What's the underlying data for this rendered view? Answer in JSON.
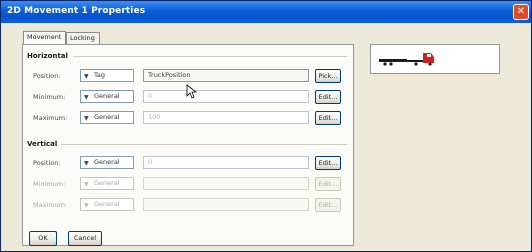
{
  "window": {
    "title": "2D Movement 1 Properties"
  },
  "tabs": [
    {
      "label": "Movement"
    },
    {
      "label": "Locking"
    }
  ],
  "horizontal": {
    "heading": "Horizontal",
    "position": {
      "label": "Position:",
      "type": "Tag",
      "value": "TruckPosition",
      "button": "Pick..."
    },
    "minimum": {
      "label": "Minimum:",
      "type": "General",
      "value": "0",
      "button": "Edit..."
    },
    "maximum": {
      "label": "Maximum:",
      "type": "General",
      "value": "100",
      "button": "Edit..."
    }
  },
  "vertical": {
    "heading": "Vertical",
    "position": {
      "label": "Position:",
      "type": "General",
      "value": "0",
      "button": "Edit..."
    },
    "minimum": {
      "label": "Minimum:",
      "type": "General",
      "value": "",
      "button": "Edit..."
    },
    "maximum": {
      "label": "Maximum:",
      "type": "General",
      "value": "",
      "button": "Edit..."
    }
  },
  "footer": {
    "ok": "OK",
    "cancel": "Cancel"
  },
  "close_icon": "close-icon",
  "colors": {
    "titlebar": "#0a5fd8",
    "truck_cab": "#d42020",
    "truck_trailer": "#1a1a1a"
  }
}
